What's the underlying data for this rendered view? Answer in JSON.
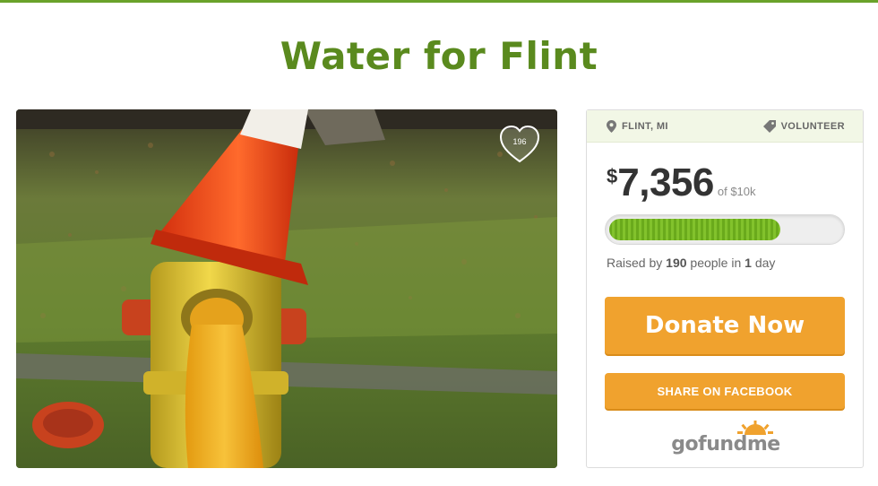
{
  "campaign": {
    "title": "Water for Flint",
    "likes": "196"
  },
  "card": {
    "location": "FLINT, MI",
    "category": "VOLUNTEER",
    "currency": "$",
    "amount": "7,356",
    "goal": "of $10k",
    "progress_fraction": 0.74,
    "raised_prefix": "Raised by",
    "people_count": "190",
    "people_mid": "people in",
    "days_count": "1",
    "days_suffix": "day",
    "donate_label": "Donate Now",
    "share_label": "SHARE ON FACEBOOK",
    "logo_go": "go",
    "logo_fund": "fund",
    "logo_me": "me"
  },
  "colors": {
    "brand_green": "#5a8a1e",
    "progress_green": "#6aaa1c",
    "button_orange": "#f0a22e"
  },
  "icons": [
    "location-pin-icon",
    "tag-icon",
    "heart-icon",
    "gofundme-sun-icon"
  ]
}
